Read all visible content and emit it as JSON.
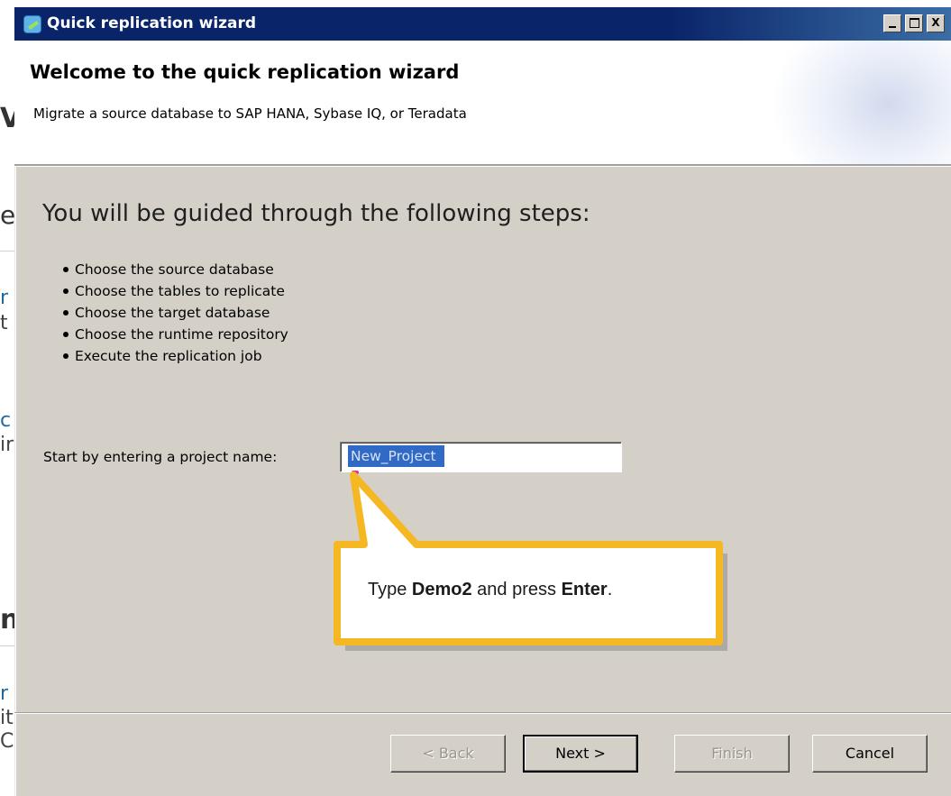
{
  "background_fragments": [
    "V",
    "e",
    "r",
    "t",
    "c",
    "ir",
    "n",
    "r",
    "it",
    "C"
  ],
  "window": {
    "title": "Quick replication wizard",
    "controls": {
      "minimize": "_",
      "maximize": "□",
      "close": "X"
    }
  },
  "header": {
    "title": "Welcome to the quick replication wizard",
    "subtitle": "Migrate a source database to SAP HANA, Sybase IQ, or Teradata"
  },
  "steps": {
    "heading": "You will be guided through the following steps:",
    "items": [
      "Choose the source database",
      "Choose the tables to replicate",
      "Choose the target database",
      "Choose the runtime repository",
      "Execute the replication job"
    ]
  },
  "project": {
    "label": "Start by entering a project name:",
    "value": "New_Project"
  },
  "callout": {
    "prefix": "Type ",
    "bold1": "Demo2",
    "middle": " and press ",
    "bold2": "Enter",
    "suffix": "."
  },
  "buttons": {
    "back": "< Back",
    "next": "Next >",
    "finish": "Finish",
    "cancel": "Cancel"
  },
  "colors": {
    "titlebar": "#0a246a",
    "dialog_bg": "#d4d0c8",
    "selection": "#316ac5",
    "callout_border": "#f5b722"
  }
}
